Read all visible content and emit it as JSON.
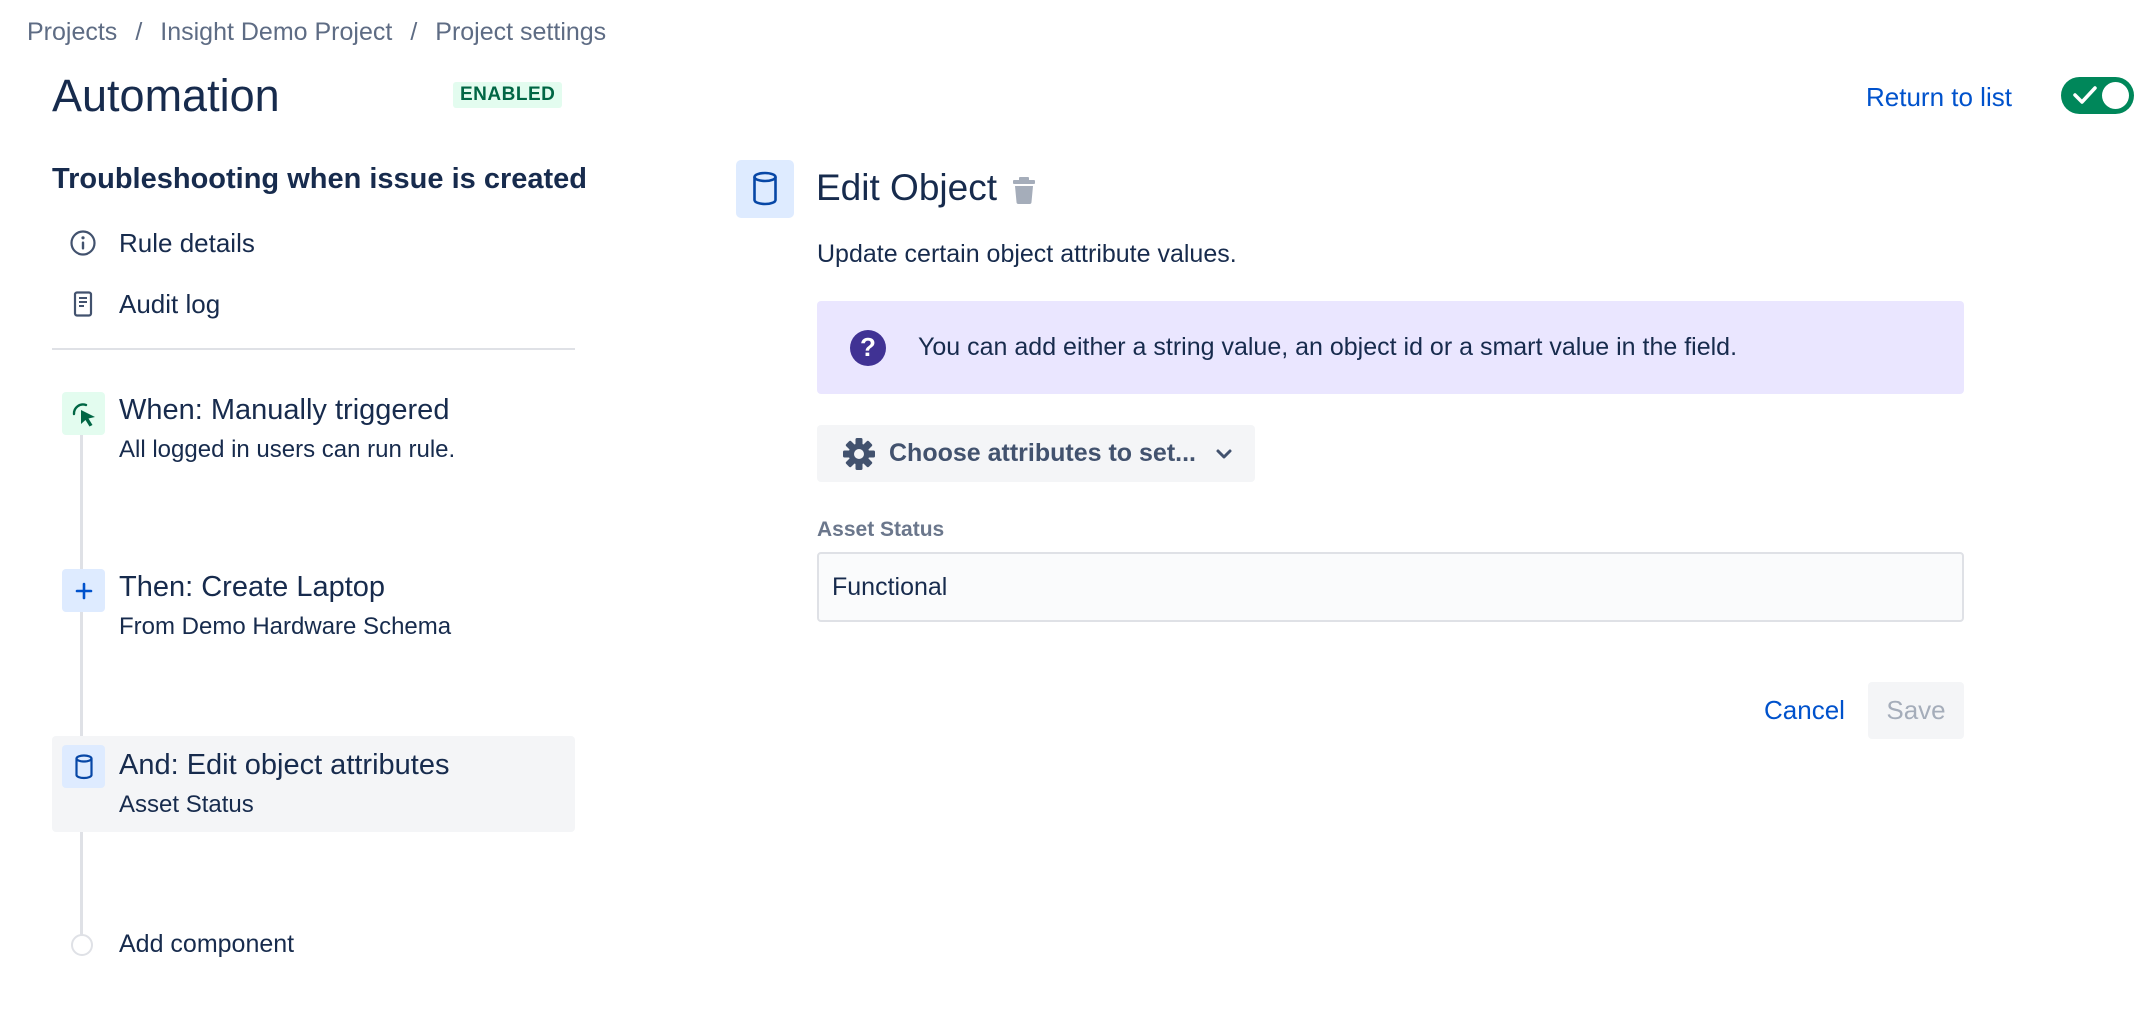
{
  "breadcrumb": {
    "items": [
      "Projects",
      "Insight Demo Project",
      "Project settings"
    ],
    "separator": "/"
  },
  "header": {
    "title": "Automation",
    "status_badge": "ENABLED",
    "return_link": "Return to list",
    "rule_enabled": true
  },
  "sidebar": {
    "rule_name": "Troubleshooting when issue is created",
    "links": [
      {
        "label": "Rule details",
        "icon": "info-icon"
      },
      {
        "label": "Audit log",
        "icon": "audit-log-icon"
      }
    ],
    "steps": [
      {
        "title": "When: Manually triggered",
        "subtitle": "All logged in users can run rule.",
        "icon": "cursor-trigger-icon"
      },
      {
        "title": "Then: Create Laptop",
        "subtitle": "From Demo Hardware Schema",
        "icon": "plus-icon"
      },
      {
        "title": "And: Edit object attributes",
        "subtitle": "Asset Status",
        "icon": "object-icon",
        "active": true
      }
    ],
    "add_component": "Add component"
  },
  "editor": {
    "title": "Edit Object",
    "description": "Update certain object attribute values.",
    "info_message": "You can add either a string value, an object id or a smart value in the field.",
    "attributes_button": "Choose attributes to set...",
    "field_label": "Asset Status",
    "field_value": "Functional",
    "cancel_label": "Cancel",
    "save_label": "Save"
  },
  "colors": {
    "primary": "#0052cc",
    "success": "#00875a",
    "info_bg": "#eae6ff",
    "info_icon": "#403294"
  }
}
